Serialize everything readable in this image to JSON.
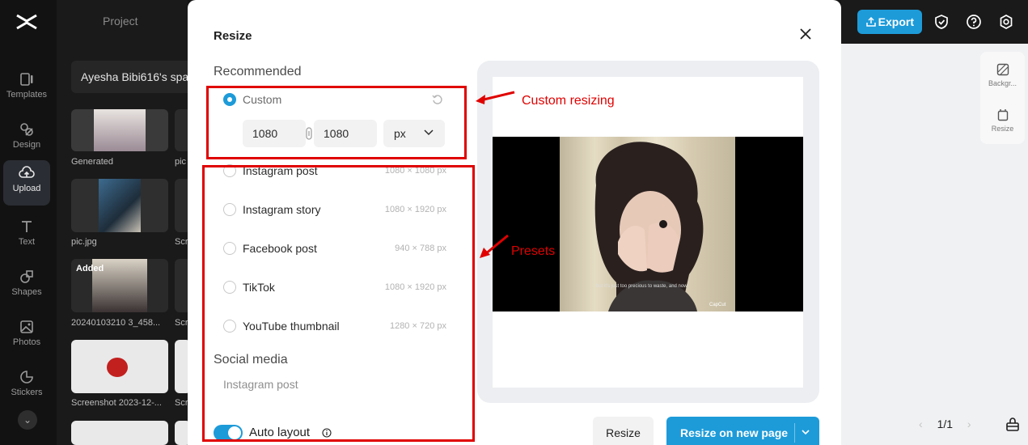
{
  "app": {
    "panel_title": "Project",
    "space_name": "Ayesha Bibi616's space",
    "nav": [
      {
        "label": "Templates",
        "icon": "templates-icon"
      },
      {
        "label": "Design",
        "icon": "design-icon"
      },
      {
        "label": "Upload",
        "icon": "upload-icon"
      },
      {
        "label": "Text",
        "icon": "text-icon"
      },
      {
        "label": "Shapes",
        "icon": "shapes-icon"
      },
      {
        "label": "Photos",
        "icon": "photos-icon"
      },
      {
        "label": "Stickers",
        "icon": "stickers-icon"
      }
    ],
    "thumbnails": [
      {
        "label": "Generated"
      },
      {
        "label": "pic"
      },
      {
        "label": "pic.jpg"
      },
      {
        "label": "Scr"
      },
      {
        "label": "20240103210 3_458...",
        "badge": "Added"
      },
      {
        "label": "Scr"
      },
      {
        "label": "Screenshot 2023-12-..."
      },
      {
        "label": "Scr"
      }
    ],
    "export_label": "Export",
    "right_tools": [
      {
        "label": "Backgr..."
      },
      {
        "label": "Resize"
      }
    ],
    "pager": {
      "current": "1/1"
    }
  },
  "modal": {
    "title": "Resize",
    "recommended_heading": "Recommended",
    "custom": {
      "label": "Custom",
      "width": "1080",
      "height": "1080",
      "unit": "px"
    },
    "presets": [
      {
        "label": "Instagram post",
        "size": "1080 × 1080 px"
      },
      {
        "label": "Instagram story",
        "size": "1080 × 1920 px"
      },
      {
        "label": "Facebook post",
        "size": "940 × 788 px"
      },
      {
        "label": "TikTok",
        "size": "1080 × 1920 px"
      },
      {
        "label": "YouTube thumbnail",
        "size": "1280 × 720 px"
      }
    ],
    "social_heading": "Social media",
    "social_first": "Instagram post",
    "auto_layout_label": "Auto layout",
    "auto_layout_on": true,
    "preview": {
      "caption": "but it's just too precious to waste, and now",
      "watermark": "CapCut"
    },
    "btn_resize": "Resize",
    "btn_resize_new": "Resize on new page"
  },
  "annotations": {
    "custom_label": "Custom resizing",
    "presets_label": "Presets",
    "color": "#e00000"
  },
  "colors": {
    "accent": "#1d9bd9"
  }
}
